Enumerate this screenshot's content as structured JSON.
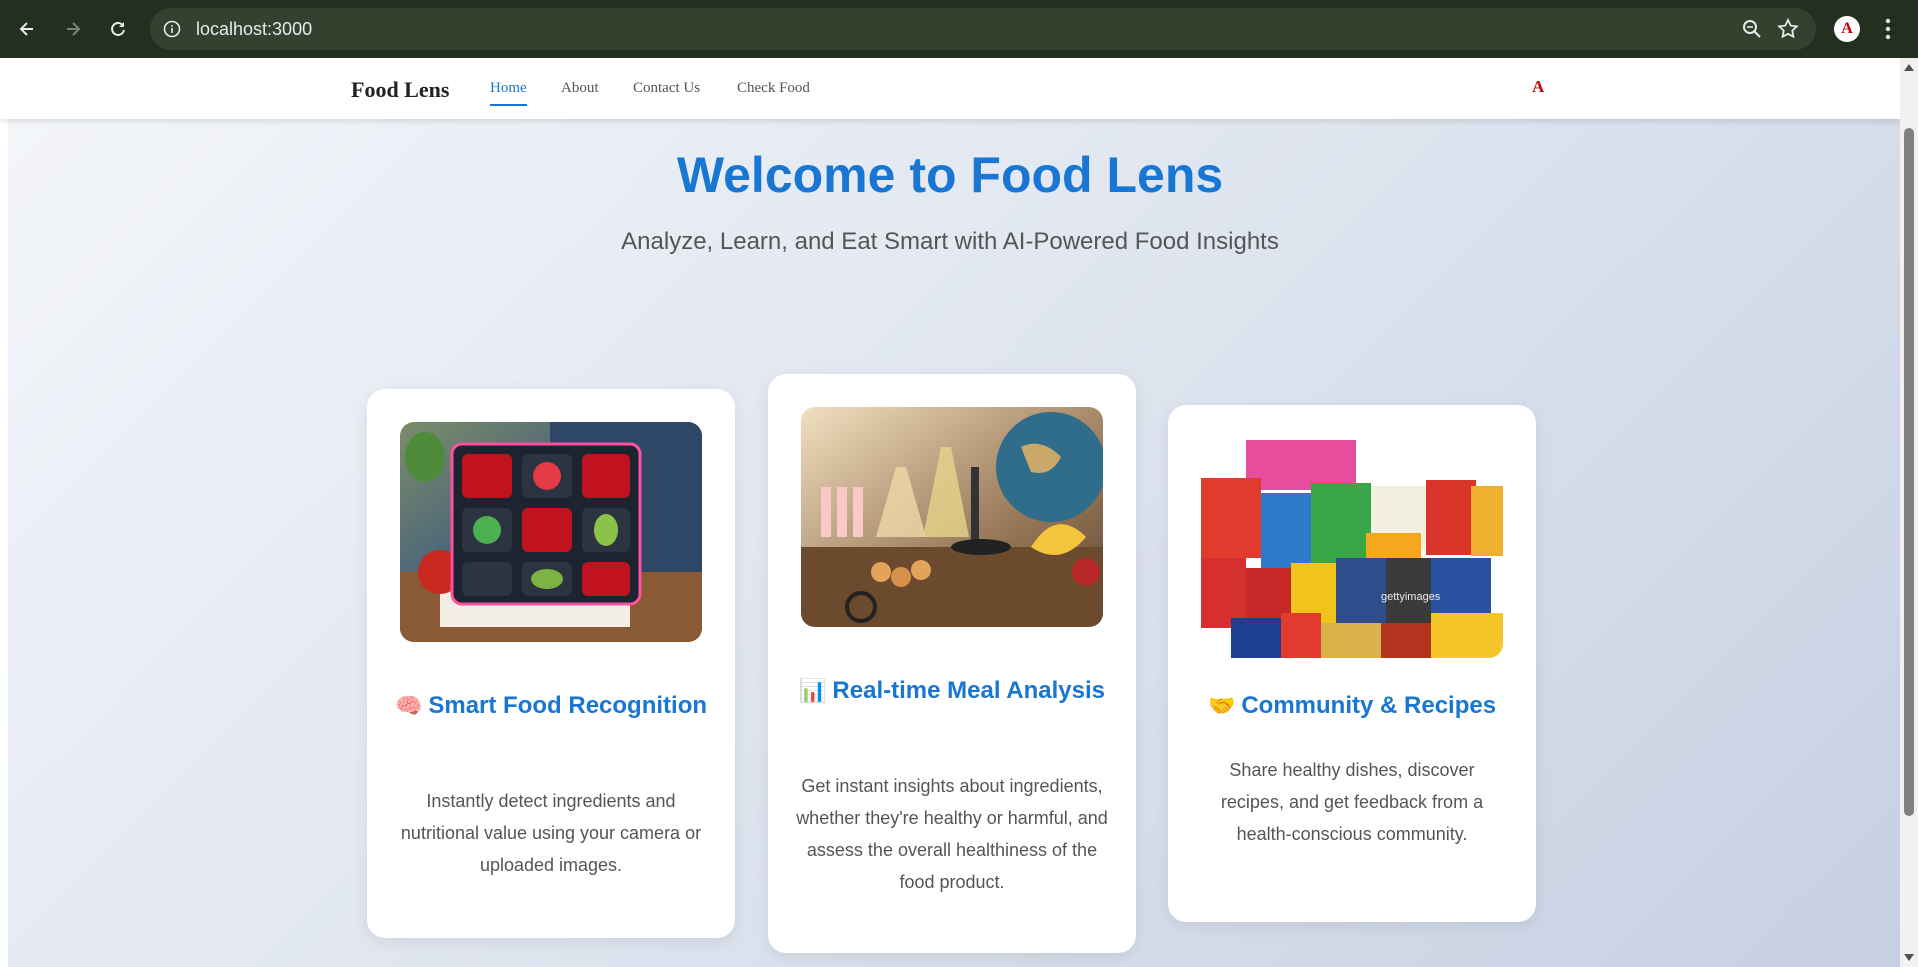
{
  "browser": {
    "url": "localhost:3000",
    "profile_initial": "A"
  },
  "navbar": {
    "brand": "Food Lens",
    "links": [
      {
        "label": "Home",
        "active": true
      },
      {
        "label": "About",
        "active": false
      },
      {
        "label": "Contact Us",
        "active": false
      },
      {
        "label": "Check Food",
        "active": false
      }
    ],
    "user_initial": "A"
  },
  "hero": {
    "title": "Welcome to Food Lens",
    "subtitle": "Analyze, Learn, and Eat Smart with AI-Powered Food Insights"
  },
  "cards": [
    {
      "emoji": "🧠",
      "title": "Smart Food Recognition",
      "description": "Instantly detect ingredients and nutritional value using your camera or uploaded images.",
      "image_icon": "ai-food-grid-image"
    },
    {
      "emoji": "📊",
      "title": "Real-time Meal Analysis",
      "description": "Get instant insights about ingredients, whether they're healthy or harmful, and assess the overall healthiness of the food product.",
      "image_icon": "lab-analysis-image"
    },
    {
      "emoji": "🤝",
      "title": "Community & Recipes",
      "description": "Share healthy dishes, discover recipes, and get feedback from a health-conscious community.",
      "image_icon": "packaged-foods-image",
      "image_watermark": "gettyimages"
    }
  ],
  "colors": {
    "accent": "#1976d2",
    "chrome_bg": "#23301f",
    "user_mark": "#d00000"
  }
}
